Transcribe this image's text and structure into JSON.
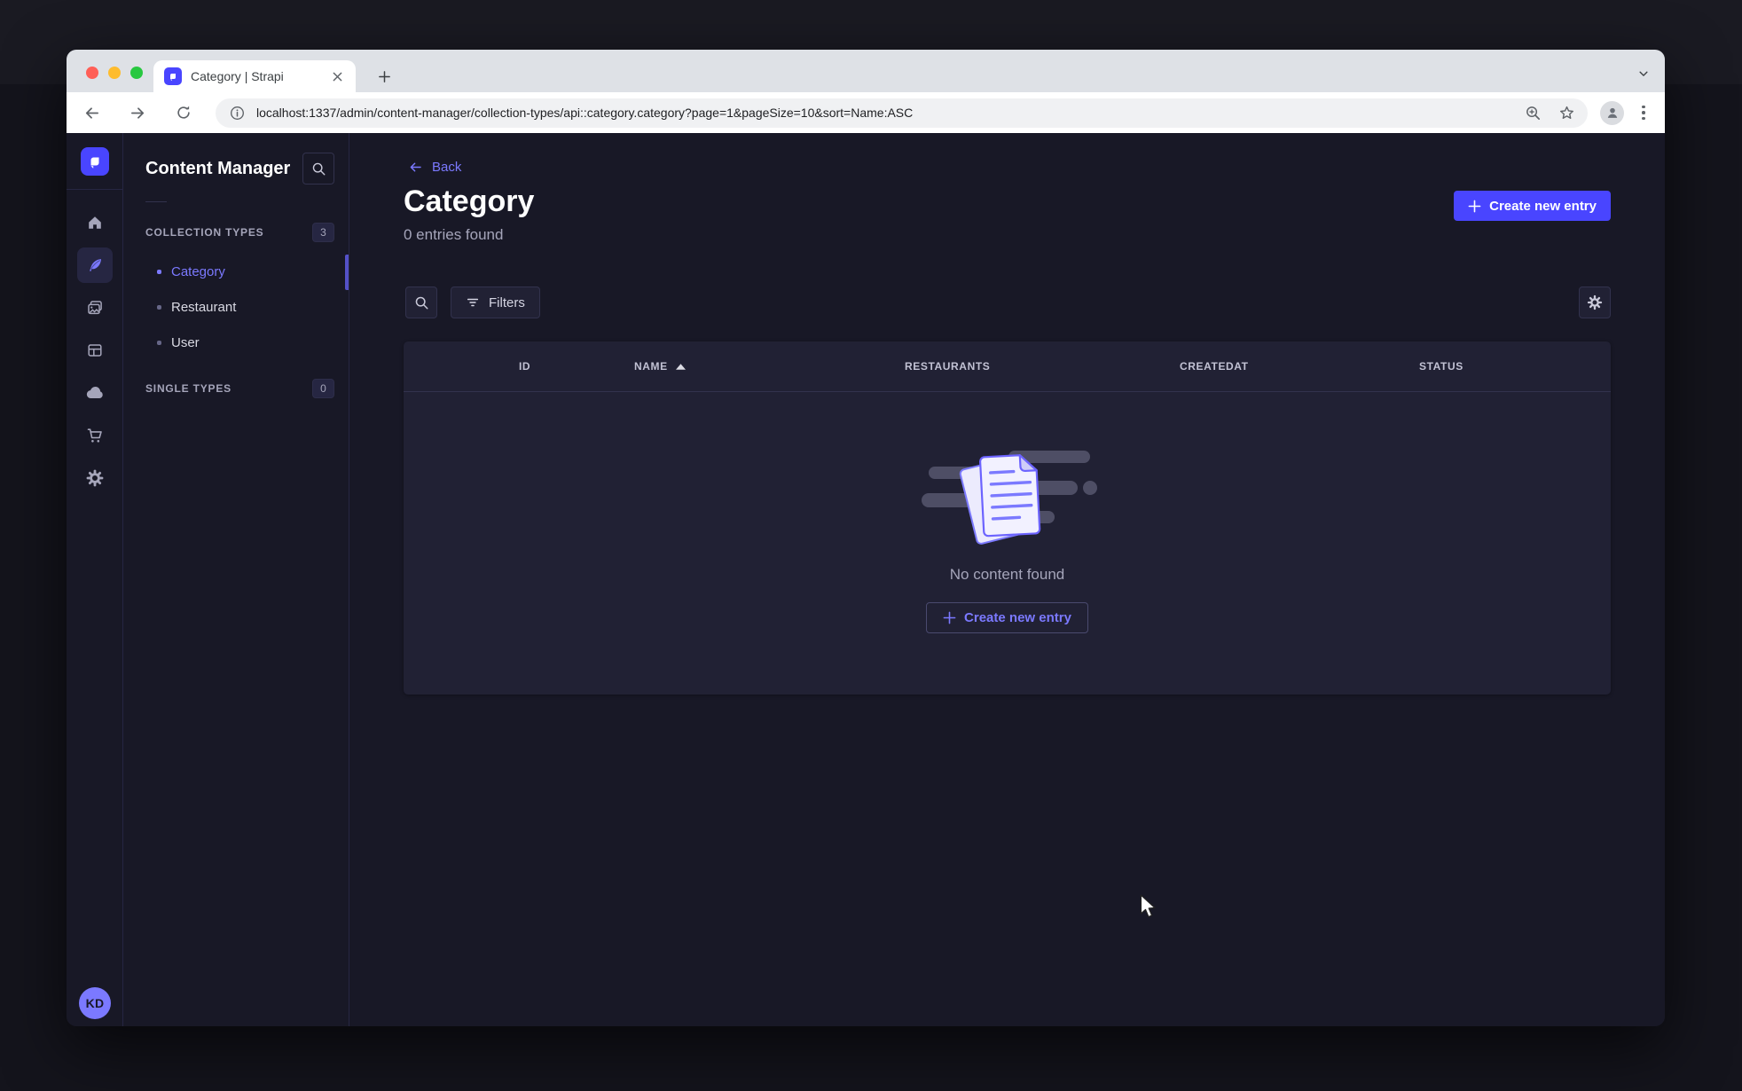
{
  "colors": {
    "primary": "#4945ff",
    "primary_light": "#7b79ff",
    "app_background": "#181826",
    "card_background": "#212134",
    "border": "#32324d",
    "text_muted": "#a5a5ba"
  },
  "browser": {
    "tab_title": "Category | Strapi",
    "url": "localhost:1337/admin/content-manager/collection-types/api::category.category?page=1&pageSize=10&sort=Name:ASC",
    "icons": [
      "back-arrow",
      "forward-arrow",
      "reload",
      "site-info",
      "zoom-in",
      "bookmark-star",
      "profile",
      "menu-kebab"
    ]
  },
  "nav_rail": {
    "logo_icon": "strapi-logo",
    "items": [
      "home",
      "content-manager",
      "media-library",
      "content-type-builder",
      "cloud",
      "marketplace",
      "settings"
    ],
    "active_item": "content-manager",
    "avatar_initials": "KD"
  },
  "subnav": {
    "title": "Content Manager",
    "search_icon": "search",
    "sections": [
      {
        "label": "COLLECTION TYPES",
        "badge": "3",
        "items": [
          {
            "label": "Category",
            "active": true
          },
          {
            "label": "Restaurant",
            "active": false
          },
          {
            "label": "User",
            "active": false
          }
        ]
      },
      {
        "label": "SINGLE TYPES",
        "badge": "0",
        "items": []
      }
    ]
  },
  "header": {
    "back_label": "Back",
    "title": "Category",
    "subtitle": "0 entries found",
    "create_button_label": "Create new entry"
  },
  "toolbar": {
    "search_icon": "search",
    "filters_label": "Filters",
    "settings_icon": "gear"
  },
  "table": {
    "columns": [
      "ID",
      "NAME",
      "RESTAURANTS",
      "CREATEDAT",
      "STATUS"
    ],
    "sorted_column": "NAME",
    "sort_direction": "asc"
  },
  "empty_state": {
    "illustration": "documents-empty-state",
    "message": "No content found",
    "create_button_label": "Create new entry"
  },
  "help": {
    "icon_glyph": "?"
  }
}
